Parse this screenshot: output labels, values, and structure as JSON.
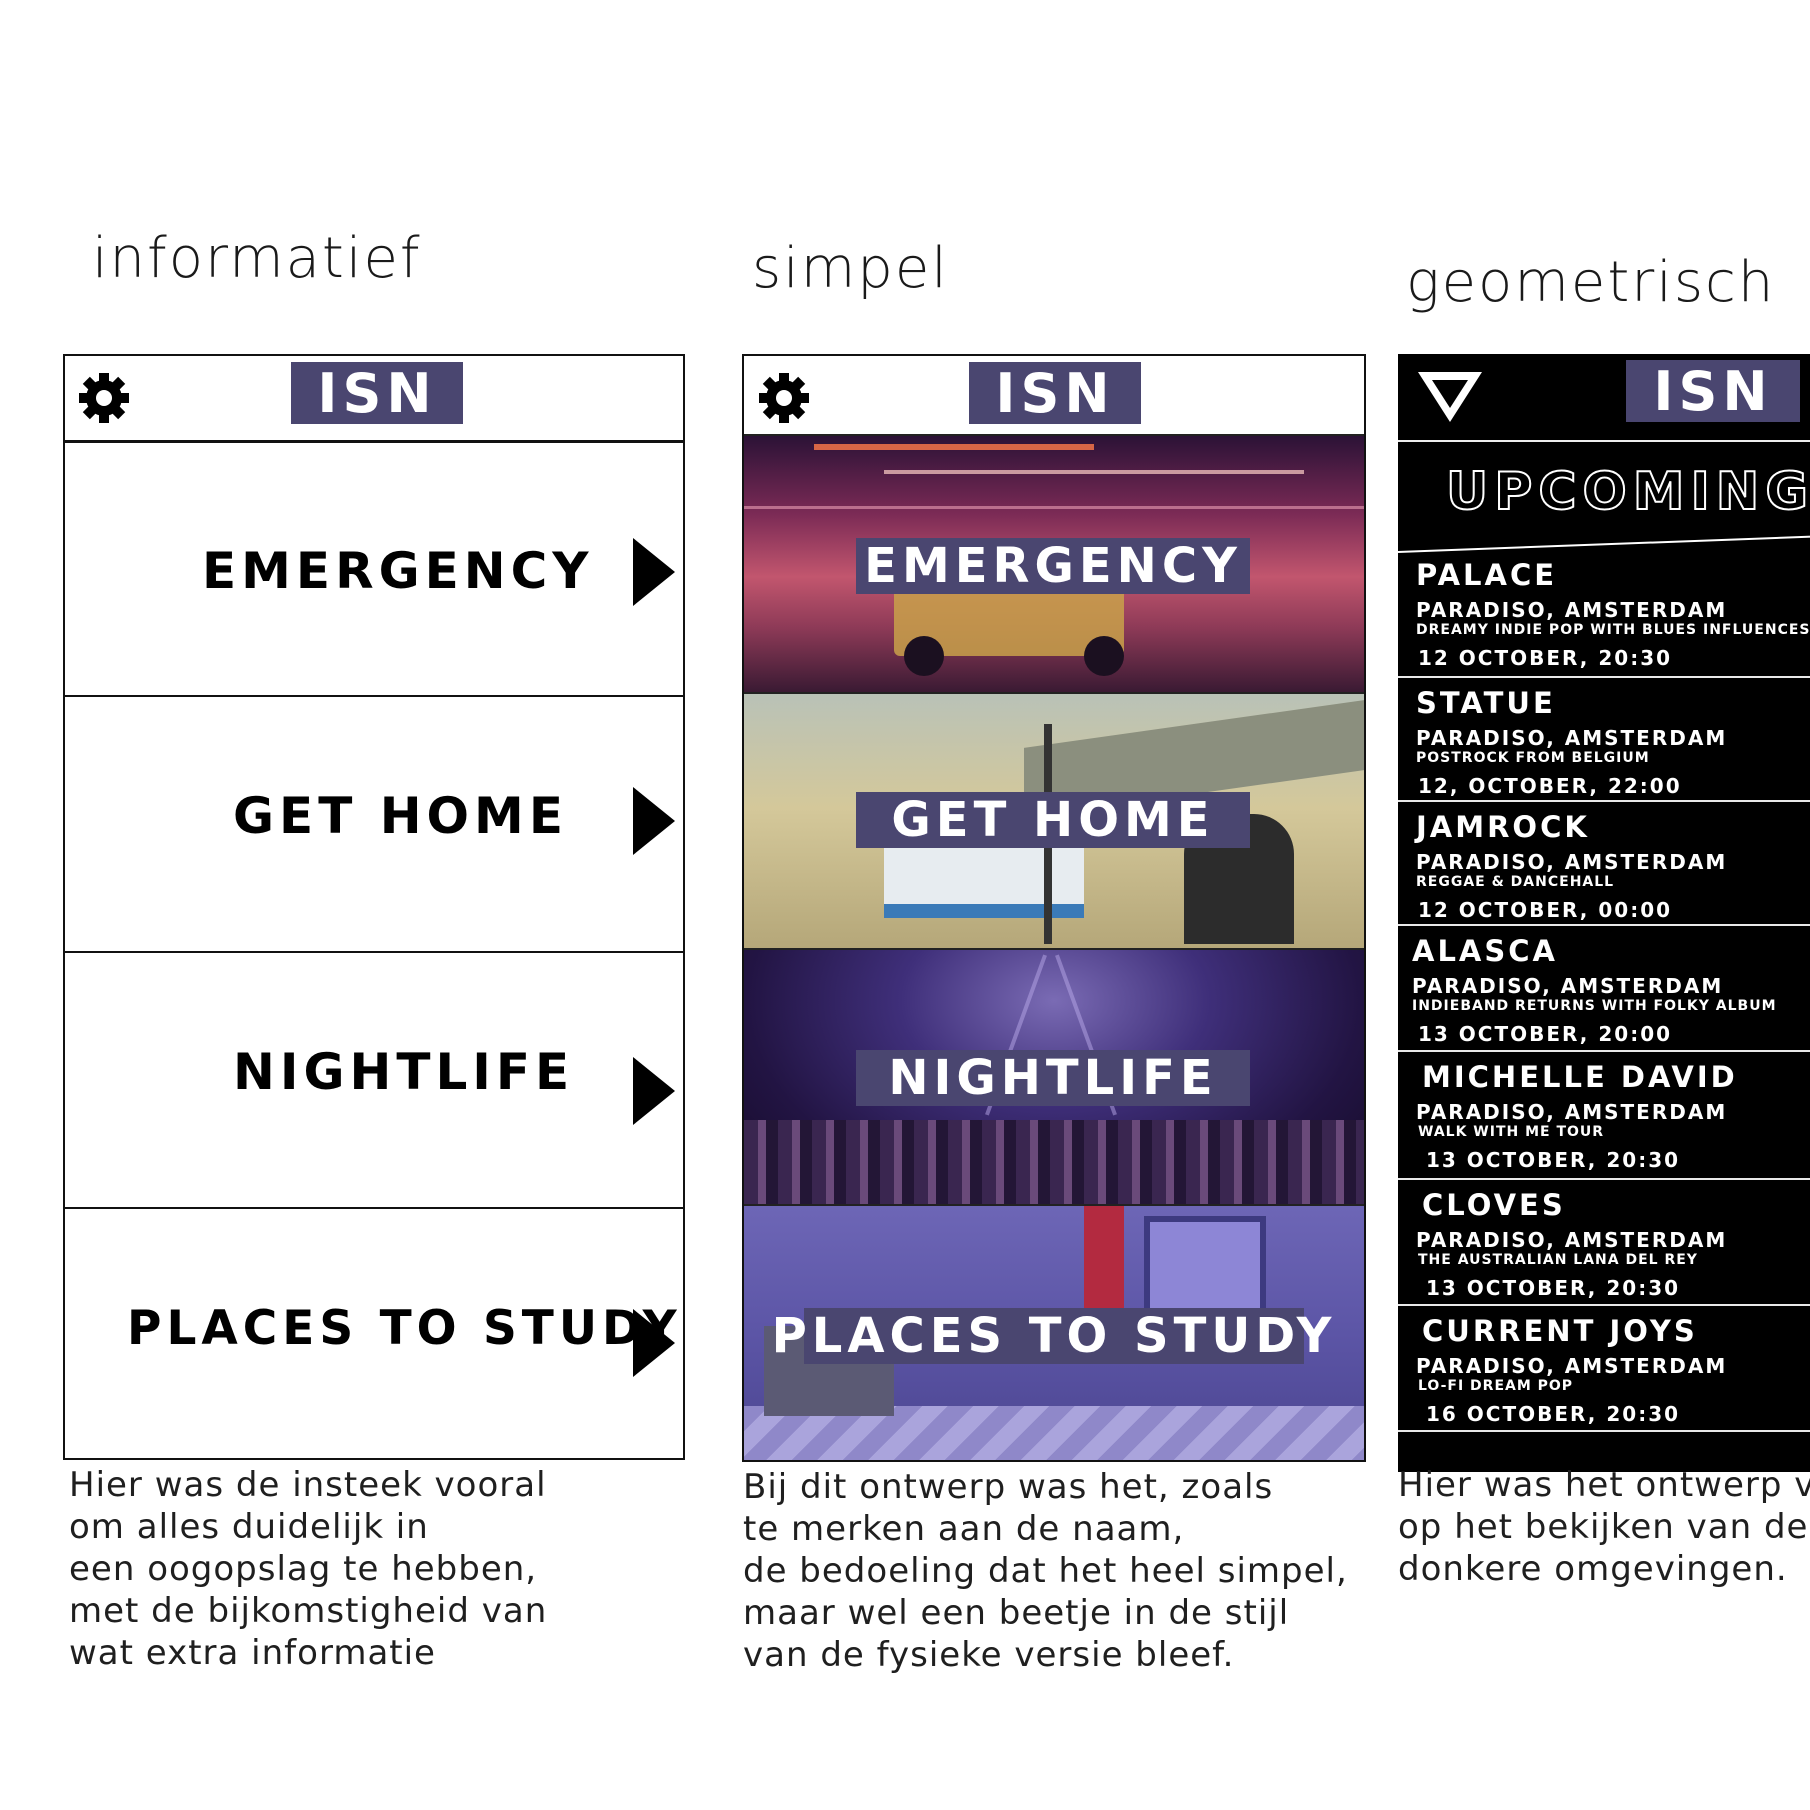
{
  "columns": {
    "informatief": {
      "title": "informatief",
      "description": [
        "Hier was de insteek vooral",
        "om alles duidelijk in",
        "een oogopslag te hebben,",
        "met de bijkomstigheid van",
        "wat extra informatie"
      ]
    },
    "simpel": {
      "title": "simpel",
      "description": [
        "Bij dit ontwerp was het, zoals",
        "te merken aan de naam,",
        "de bedoeling dat het heel simpel,",
        "maar wel een beetje in de stijl",
        "van de fysieke versie bleef."
      ]
    },
    "geometrisch": {
      "title": "geometrisch",
      "description": [
        "Hier was het ontwerp vo",
        "op het bekijken van de a",
        "donkere omgevingen."
      ]
    }
  },
  "app": {
    "logo": "ISN"
  },
  "menu": [
    {
      "label": "EMERGENCY"
    },
    {
      "label": "GET HOME"
    },
    {
      "label": "NIGHTLIFE"
    },
    {
      "label": "PLACES TO STUDY"
    }
  ],
  "events": {
    "heading": "UPCOMING EV",
    "items": [
      {
        "name": "PALACE",
        "venue": "PARADISO, AMSTERDAM",
        "desc": "DREAMY INDIE POP WITH BLUES INFLUENCES",
        "time": "12 OCTOBER, 20:30"
      },
      {
        "name": "STATUE",
        "venue": "PARADISO, AMSTERDAM",
        "desc": "POSTROCK FROM BELGIUM",
        "time": "12, OCTOBER, 22:00"
      },
      {
        "name": "JAMROCK",
        "venue": "PARADISO, AMSTERDAM",
        "desc": "REGGAE & DANCEHALL",
        "time": "12 OCTOBER, 00:00"
      },
      {
        "name": "ALASCA",
        "venue": "PARADISO, AMSTERDAM",
        "desc": "INDIEBAND RETURNS WITH FOLKY ALBUM",
        "time": "13 OCTOBER, 20:00"
      },
      {
        "name": "MICHELLE DAVID",
        "venue": "PARADISO, AMSTERDAM",
        "desc": "WALK WITH ME TOUR",
        "time": "13 OCTOBER, 20:30"
      },
      {
        "name": "CLOVES",
        "venue": "PARADISO, AMSTERDAM",
        "desc": "THE AUSTRALIAN LANA DEL REY",
        "time": "13 OCTOBER, 20:30"
      },
      {
        "name": "CURRENT JOYS",
        "venue": "PARADISO, AMSTERDAM",
        "desc": "LO-FI DREAM POP",
        "time": "16 OCTOBER, 20:30"
      }
    ]
  },
  "icons": {
    "settings": "gear-icon",
    "filter": "filter-triangle-icon",
    "next": "play-arrow-icon"
  },
  "colors": {
    "accent": "#4a4670",
    "dark": "#000000"
  }
}
